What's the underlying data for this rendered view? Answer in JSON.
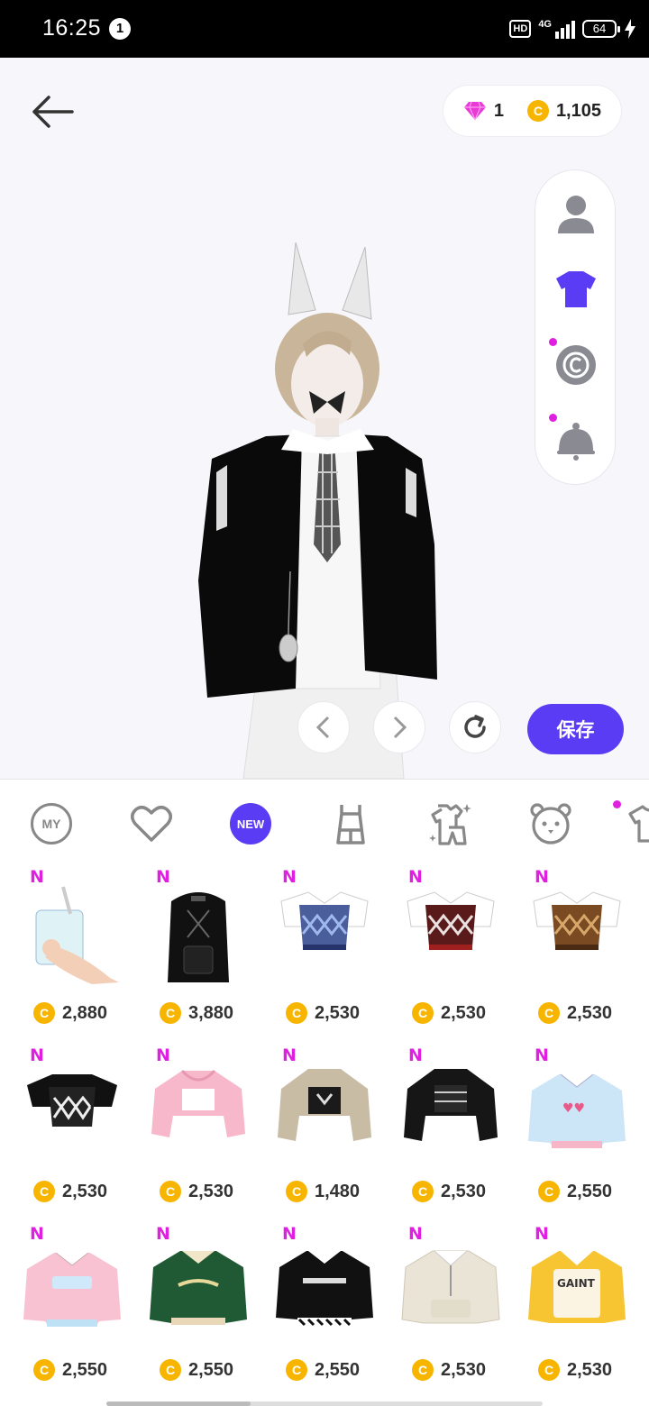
{
  "status_bar": {
    "time": "16:25",
    "notification_count": "1",
    "hd_label": "HD",
    "network_label": "4G",
    "battery": "64"
  },
  "header": {
    "gems": "1",
    "coins": "1,105",
    "coin_symbol": "C",
    "gem_color": "#e93ad8",
    "coin_color": "#f7b500"
  },
  "side_tools": [
    "avatar-icon",
    "outfit-icon",
    "copyright-icon",
    "bell-icon"
  ],
  "controls": {
    "save_label": "保存",
    "accent_color": "#5b3cf5"
  },
  "categories": [
    {
      "name": "my",
      "label": "MY"
    },
    {
      "name": "favorites",
      "icon": "heart-icon"
    },
    {
      "name": "new",
      "label": "NEW",
      "selected": true
    },
    {
      "name": "dress",
      "icon": "dress-icon"
    },
    {
      "name": "outfit",
      "icon": "sparkle-outfit-icon"
    },
    {
      "name": "bear",
      "icon": "bear-icon"
    },
    {
      "name": "tops",
      "icon": "shirt-icon"
    }
  ],
  "items": [
    {
      "badge": "N",
      "thing": "bubble tea cup",
      "price": "2,880"
    },
    {
      "badge": "N",
      "thing": "black backpack",
      "price": "3,880"
    },
    {
      "badge": "N",
      "thing": "blue argyle vest",
      "price": "2,530"
    },
    {
      "badge": "N",
      "thing": "red argyle vest",
      "price": "2,530"
    },
    {
      "badge": "N",
      "thing": "brown argyle vest",
      "price": "2,530"
    },
    {
      "badge": "N",
      "thing": "black argyle crop top",
      "price": "2,530"
    },
    {
      "badge": "N",
      "thing": "pink cropped jacket",
      "price": "2,530"
    },
    {
      "badge": "N",
      "thing": "beige cropped jacket",
      "price": "1,480"
    },
    {
      "badge": "N",
      "thing": "black cropped jacket",
      "price": "2,530"
    },
    {
      "badge": "N",
      "thing": "blue puffer sweater",
      "price": "2,550"
    },
    {
      "badge": "N",
      "thing": "pink puffer sweater",
      "price": "2,550"
    },
    {
      "badge": "N",
      "thing": "green varsity jacket",
      "price": "2,550"
    },
    {
      "badge": "N",
      "thing": "black track jacket",
      "price": "2,550"
    },
    {
      "badge": "N",
      "thing": "cream zip pullover",
      "price": "2,530"
    },
    {
      "badge": "N",
      "thing": "yellow hoodie",
      "price": "2,530"
    }
  ]
}
